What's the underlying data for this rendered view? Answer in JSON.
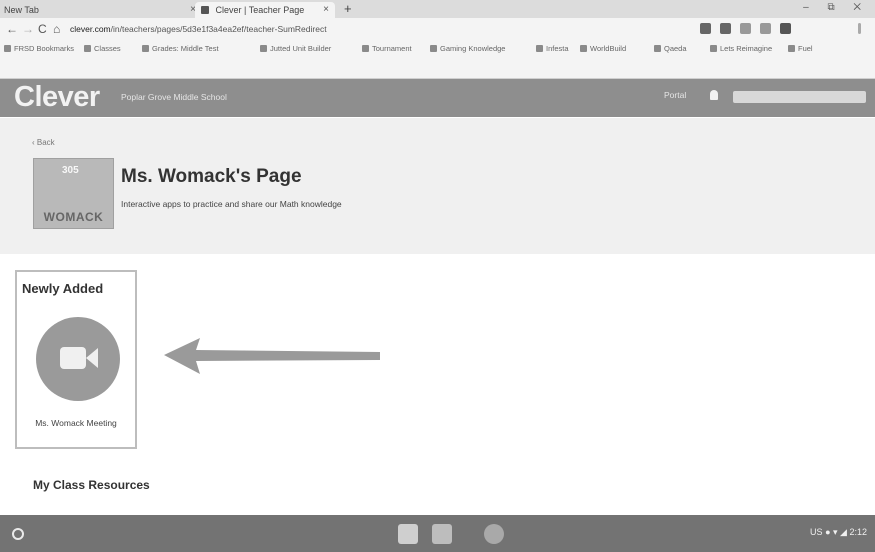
{
  "browser": {
    "tabs": [
      {
        "label": "New Tab"
      },
      {
        "label": "Clever | Teacher Page"
      }
    ],
    "new_tab_symbol": "+",
    "close_symbol": "×",
    "window_controls": "– ⧉ ✕",
    "nav": {
      "back": "←",
      "forward": "→",
      "reload": "C",
      "home": "⌂"
    },
    "url_domain": "clever.com",
    "url_path": "/in/teachers/pages/5d3e1f3a4ea2ef/teacher-SumRedirect"
  },
  "bookmarks": [
    "FRSD Bookmarks",
    "Classes",
    "Grades: Middle Test",
    "Jutted Unit Builder",
    "Tournament",
    "Gaming Knowledge",
    "Infesta",
    "WorldBuild",
    "Qaeda",
    "Lets Reimagine",
    "Fuel"
  ],
  "clever_header": {
    "logo": "Clever",
    "school": "Poplar Grove Middle School",
    "portal": "Portal",
    "icons": {
      "notifications": "bell-icon"
    }
  },
  "page_header": {
    "back": "‹ Back",
    "image_number": "305",
    "image_label": "WOMACK",
    "title": "Ms. Womack's Page",
    "description": "Interactive apps to practice and share our Math knowledge"
  },
  "newly_added": {
    "heading": "Newly Added",
    "apps": [
      {
        "name": "Ms. Womack Meeting",
        "icon": "video-camera-icon",
        "color": "#9a9a9a"
      }
    ]
  },
  "my_class_resources": {
    "heading": "My Class Resources"
  },
  "shelf": {
    "status": "US",
    "time": "2:12",
    "colors": {
      "shelf": "#737373",
      "header": "#8e8e8e"
    }
  }
}
